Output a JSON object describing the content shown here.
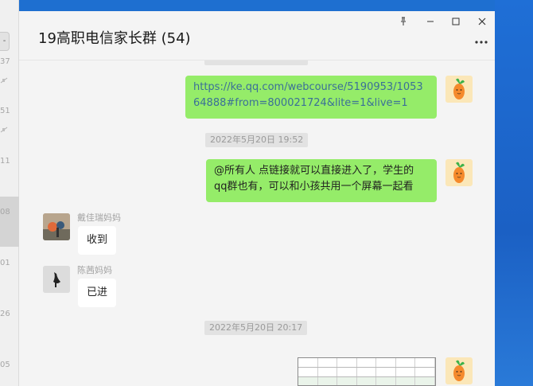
{
  "window": {
    "title": "19高职电信家长群 (54)",
    "controls": {
      "pin": "pin-icon",
      "minimize": "minimize-icon",
      "maximize": "maximize-icon",
      "close": "close-icon",
      "more": "more-icon"
    }
  },
  "chat_list_strip": {
    "collapse_label": "-",
    "counts": [
      "37",
      "51",
      "11",
      "08",
      "01",
      "26",
      "05"
    ]
  },
  "messages": {
    "top_timestamp": "",
    "link_line1": "https://ke.qq.com/webcourse/5190953/1053",
    "link_line2": "64888#from=800021724&lite=1&live=1",
    "ts1": "2022年5月20日 19:52",
    "msg2_line1": "@所有人 点链接就可以直接进入了，学生的",
    "msg2_line2": "qq群也有，可以和小孩共用一个屏幕一起看",
    "sender1": "戴佳瑞妈妈",
    "reply1": "收到",
    "sender2": "陈茜妈妈",
    "reply2": "已进",
    "ts2": "2022年5月20日 20:17"
  },
  "colors": {
    "own_bubble": "#95ec69",
    "link_text": "#3b6f98",
    "desktop_blue": "#1f6fd6"
  }
}
